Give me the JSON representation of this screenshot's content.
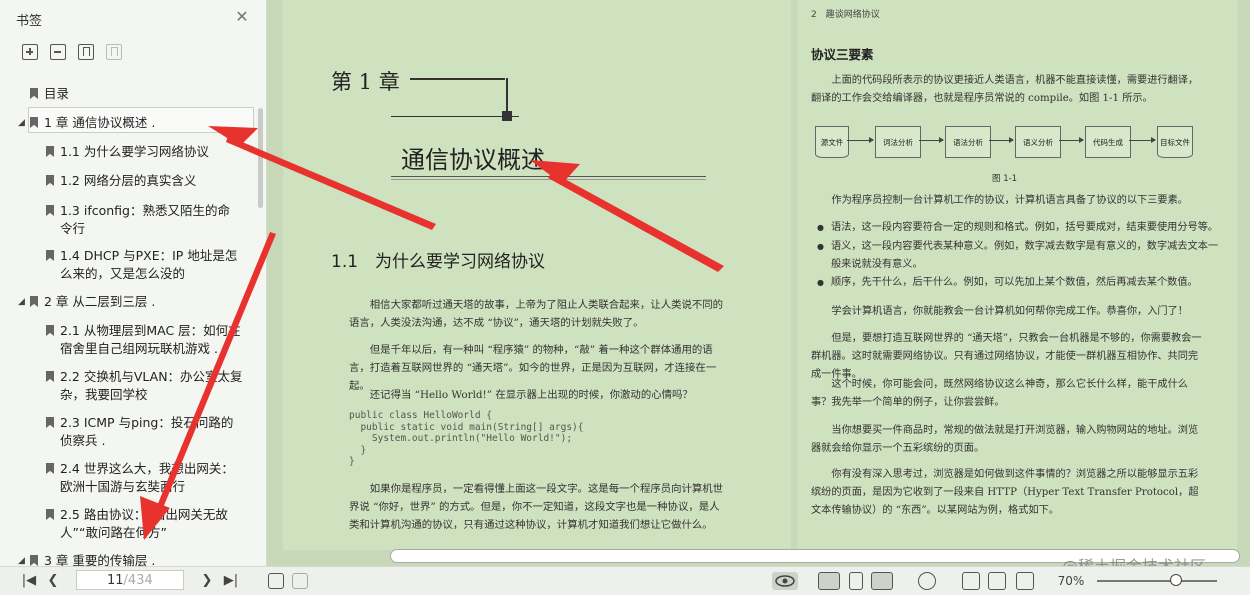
{
  "sidebar": {
    "title": "书签",
    "bookmarks": [
      {
        "label": "目录"
      },
      {
        "label": "1 章 通信协议概述 ."
      },
      {
        "label": "1.1 为什么要学习网络协议"
      },
      {
        "label": "1.2 网络分层的真实含义"
      },
      {
        "label": "1.3 ifconfig：熟悉又陌生的命令行"
      },
      {
        "label": "1.4 DHCP 与PXE：IP 地址是怎么来的，又是怎么没的"
      },
      {
        "label": "2 章 从二层到三层 ."
      },
      {
        "label": "2.1 从物理层到MAC 层：如何在宿舍里自己组网玩联机游戏 ."
      },
      {
        "label": "2.2 交换机与VLAN：办公室太复杂，我要回学校"
      },
      {
        "label": "2.3 ICMP 与ping：投石问路的侦察兵 ."
      },
      {
        "label": "2.4 世界这么大，我想出网关：欧洲十国游与玄奘西行"
      },
      {
        "label": "2.5 路由协议：“西出网关无故人”“敢问路在何方”"
      },
      {
        "label": "3 章 重要的传输层 ."
      }
    ]
  },
  "left_page": {
    "chapter_label": "第 1 章",
    "chapter_title": "通信协议概述",
    "section_title": "1.1　为什么要学习网络协议",
    "paragraphs": [
      "相信大家都听过通天塔的故事，上帝为了阻止人类联合起来，让人类说不同的语言，人类没法沟通，达不成 “协议”，通天塔的计划就失败了。",
      "但是千年以后，有一种叫 “程序猿” 的物种，“敲” 着一种这个群体通用的语言，打造着互联网世界的 “通天塔”。如今的世界，正是因为互联网，才连接在一起。",
      "还记得当 “Hello World!” 在显示器上出现的时候，你激动的心情吗？",
      "如果你是程序员，一定看得懂上面这一段文字。这是每一个程序员向计算机世界说 “你好，世界” 的方式。但是，你不一定知道，这段文字也是一种协议，是人类和计算机沟通的协议，只有通过这种协议，计算机才知道我们想让它做什么。"
    ],
    "code": "public class HelloWorld {\n  public static void main(String[] args){\n    System.out.println(\"Hello World!\");\n  }\n}"
  },
  "right_page": {
    "header": "2　趣谈网络协议",
    "section_title": "协议三要素",
    "para1": "上面的代码段所表示的协议更接近人类语言，机器不能直接读懂，需要进行翻译，翻译的工作会交给编译器，也就是程序员常说的 compile。如图 1-1 所示。",
    "figure_boxes": [
      "源文件",
      "词法分析",
      "语法分析",
      "语义分析",
      "代码生成",
      "目标文件"
    ],
    "figure_caption": "图 1-1",
    "para2": "作为程序员控制一台计算机工作的协议，计算机语言具备了协议的以下三要素。",
    "bullets": [
      "语法，这一段内容要符合一定的规则和格式。例如，括号要成对，结束要使用分号等。",
      "语义，这一段内容要代表某种意义。例如，数字减去数字是有意义的，数字减去文本一般来说就没有意义。",
      "顺序，先干什么，后干什么。例如，可以先加上某个数值，然后再减去某个数值。"
    ],
    "paragraphs": [
      "学会计算机语言，你就能教会一台计算机如何帮你完成工作。恭喜你，入门了！",
      "但是，要想打造互联网世界的 “通天塔”，只教会一台机器是不够的，你需要教会一群机器。这时就需要网络协议。只有通过网络协议，才能使一群机器互相协作、共同完成一件事。",
      "这个时候，你可能会问，既然网络协议这么神奇，那么它长什么样，能干成什么事？我先举一个简单的例子，让你尝尝鲜。",
      "当你想要买一件商品时，常规的做法就是打开浏览器，输入购物网站的地址。浏览器就会给你显示一个五彩缤纷的页面。",
      "你有没有深入思考过，浏览器是如何做到这件事情的？浏览器之所以能够显示五彩缤纷的页面，是因为它收到了一段来自 HTTP（Hyper Text Transfer Protocol，超文本传输协议）的 “东西”。以某网站为例，格式如下。"
    ]
  },
  "statusbar": {
    "current_page": "11",
    "total_pages": "/434",
    "zoom": "70%"
  },
  "watermark": "@稀土掘金技术社区",
  "colors": {
    "page_bg": "#cfe2bf",
    "annotation_arrow": "#e8322e"
  }
}
